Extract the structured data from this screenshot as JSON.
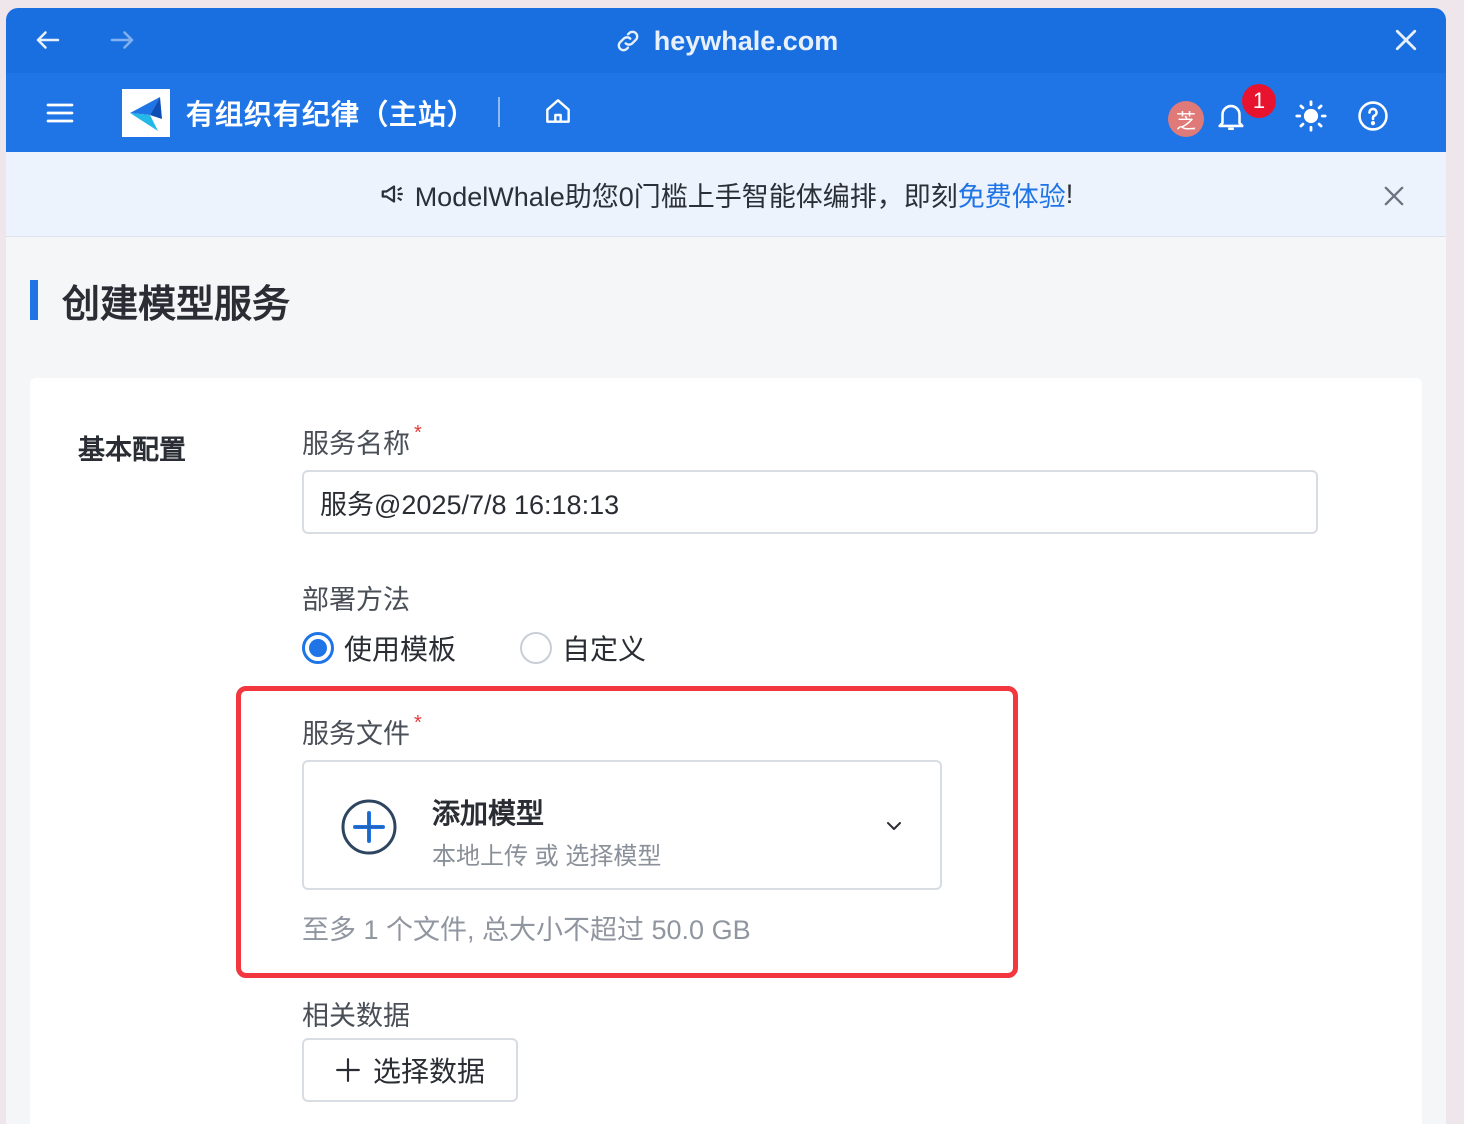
{
  "browser": {
    "url": "heywhale.com",
    "icons": {
      "back": "arrow-left-icon",
      "forward": "arrow-right-icon",
      "link": "link-icon",
      "close": "close-icon"
    }
  },
  "appbar": {
    "org_name": "有组织有纪律（主站）",
    "avatar_text": "芝",
    "notification_count": "1",
    "icons": [
      "menu-icon",
      "logo-icon",
      "home-icon",
      "bell-icon",
      "sun-icon",
      "help-icon"
    ]
  },
  "notice": {
    "prefix": "ModelWhale助您0门槛上手智能体编排，即刻",
    "link": "免费体验",
    "suffix": "!"
  },
  "page": {
    "title": "创建模型服务"
  },
  "form": {
    "section_label": "基本配置",
    "service_name": {
      "label": "服务名称",
      "required_mark": "*",
      "value": "服务@2025/7/8 16:18:13"
    },
    "deploy_method": {
      "label": "部署方法",
      "options": [
        {
          "label": "使用模板",
          "selected": true
        },
        {
          "label": "自定义",
          "selected": false
        }
      ]
    },
    "service_file": {
      "label": "服务文件",
      "required_mark": "*",
      "upload_title": "添加模型",
      "upload_subtitle": "本地上传 或 选择模型",
      "hint": "至多 1 个文件, 总大小不超过 50.0 GB"
    },
    "related_data": {
      "label": "相关数据",
      "button": "选择数据"
    }
  },
  "colors": {
    "primary": "#1f74e6",
    "browser_bar": "#1a6fe0",
    "highlight_border": "#f2373e",
    "badge": "#e8142f",
    "avatar": "#e07a78"
  }
}
